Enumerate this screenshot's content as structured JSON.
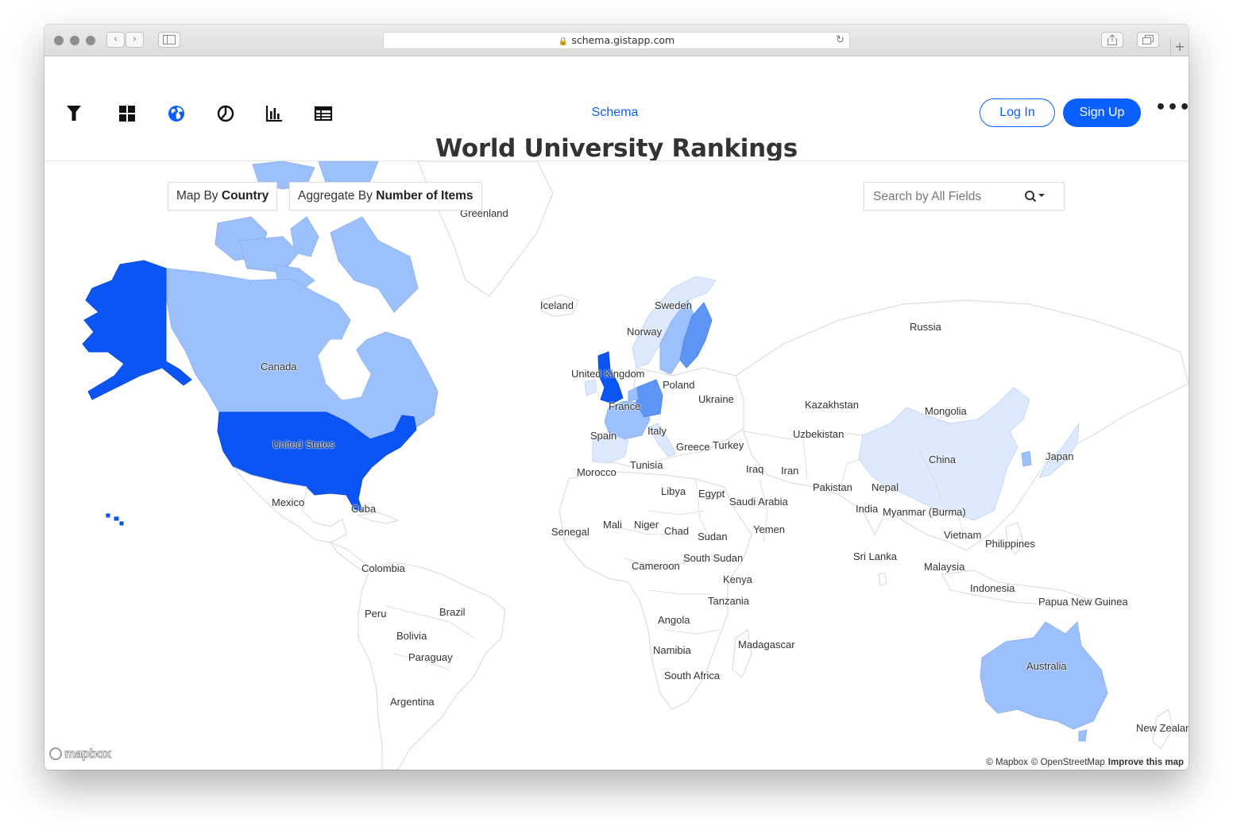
{
  "browser": {
    "url": "schema.gistapp.com",
    "back_glyph": "‹",
    "forward_glyph": "›",
    "new_tab_glyph": "+"
  },
  "toolbar": {
    "tools": [
      {
        "name": "filter-icon",
        "active": false
      },
      {
        "name": "grid-icon",
        "active": false
      },
      {
        "name": "globe-icon",
        "active": true
      },
      {
        "name": "pie-chart-icon",
        "active": false
      },
      {
        "name": "bar-chart-icon",
        "active": false
      },
      {
        "name": "table-icon",
        "active": false
      }
    ],
    "brand": "Schema",
    "login_label": "Log In",
    "signup_label": "Sign Up",
    "more_label": "•••"
  },
  "page": {
    "title": "World University Rankings"
  },
  "controls": {
    "map_by_prefix": "Map By",
    "map_by_value": "Country",
    "aggregate_prefix": "Aggregate By",
    "aggregate_value": "Number of Items",
    "search_placeholder": "Search by All Fields"
  },
  "colors": {
    "accent": "#0a5fff",
    "scale": [
      "#dce9fe",
      "#9cc0fb",
      "#5e95f7",
      "#2d72f5",
      "#0a55f4"
    ]
  },
  "map": {
    "labels": [
      "Greenland",
      "Canada",
      "United States",
      "Mexico",
      "Cuba",
      "Iceland",
      "Sweden",
      "Norway",
      "Russia",
      "United Kingdom",
      "Poland",
      "Ukraine",
      "France",
      "Kazakhstan",
      "Mongolia",
      "Spain",
      "Italy",
      "Uzbekistan",
      "Greece",
      "Turkey",
      "China",
      "Japan",
      "Tunisia",
      "Morocco",
      "Iraq",
      "Iran",
      "Pakistan",
      "Nepal",
      "Libya",
      "Egypt",
      "Saudi Arabia",
      "India",
      "Myanmar (Burma)",
      "Senegal",
      "Mali",
      "Niger",
      "Chad",
      "Sudan",
      "Yemen",
      "Vietnam",
      "Philippines",
      "Cameroon",
      "South Sudan",
      "Sri Lanka",
      "Malaysia",
      "Colombia",
      "Kenya",
      "Indonesia",
      "Tanzania",
      "Papua New Guinea",
      "Peru",
      "Brazil",
      "Angola",
      "Bolivia",
      "Paraguay",
      "Madagascar",
      "Namibia",
      "Australia",
      "South Africa",
      "Argentina",
      "New Zealand"
    ],
    "logo": "mapbox",
    "attribution": {
      "mapbox": "© Mapbox",
      "osm": "© OpenStreetMap",
      "improve": "Improve this map"
    }
  }
}
